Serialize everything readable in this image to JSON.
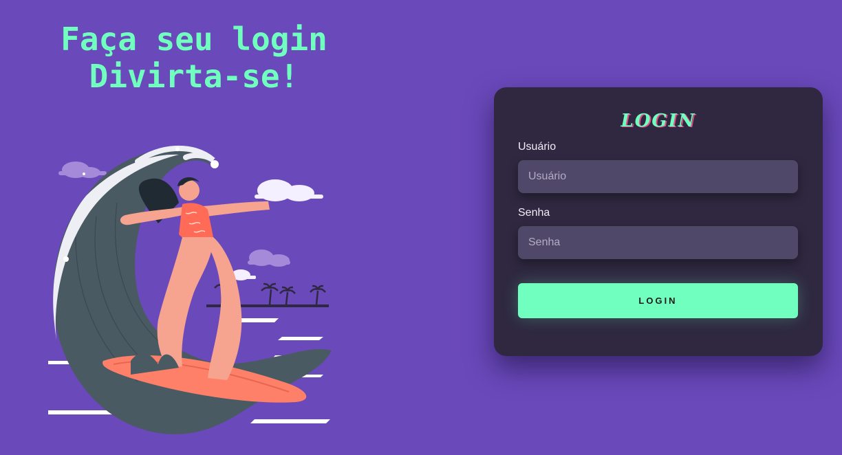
{
  "hero": {
    "line1": "Faça seu login",
    "line2": "Divirta-se!"
  },
  "login": {
    "title": "LOGIN",
    "username_label": "Usuário",
    "username_placeholder": "Usuário",
    "username_value": "",
    "password_label": "Senha",
    "password_placeholder": "Senha",
    "password_value": "",
    "submit_label": "LOGIN"
  },
  "colors": {
    "background": "#6a49bb",
    "accent": "#70ffbf",
    "card": "#2f2840",
    "input": "#504868"
  },
  "illustration": {
    "icon": "woman-surfing-wave-illustration"
  }
}
